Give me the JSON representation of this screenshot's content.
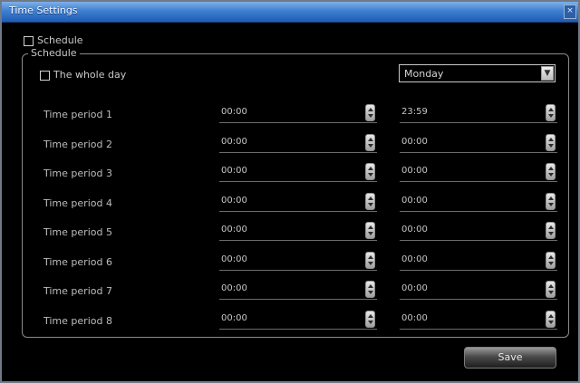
{
  "window": {
    "title": "Time Settings",
    "close_glyph": "×"
  },
  "schedule_enable": {
    "label": "Schedule",
    "checked": false
  },
  "schedule_group": {
    "legend": "Schedule"
  },
  "whole_day": {
    "label": "The whole day",
    "checked": false
  },
  "day_select": {
    "value": "Monday"
  },
  "periods": [
    {
      "label": "Time period 1",
      "start": "00:00",
      "end": "23:59"
    },
    {
      "label": "Time period 2",
      "start": "00:00",
      "end": "00:00"
    },
    {
      "label": "Time period 3",
      "start": "00:00",
      "end": "00:00"
    },
    {
      "label": "Time period 4",
      "start": "00:00",
      "end": "00:00"
    },
    {
      "label": "Time period 5",
      "start": "00:00",
      "end": "00:00"
    },
    {
      "label": "Time period 6",
      "start": "00:00",
      "end": "00:00"
    },
    {
      "label": "Time period 7",
      "start": "00:00",
      "end": "00:00"
    },
    {
      "label": "Time period 8",
      "start": "00:00",
      "end": "00:00"
    }
  ],
  "buttons": {
    "save_label": "Save"
  }
}
